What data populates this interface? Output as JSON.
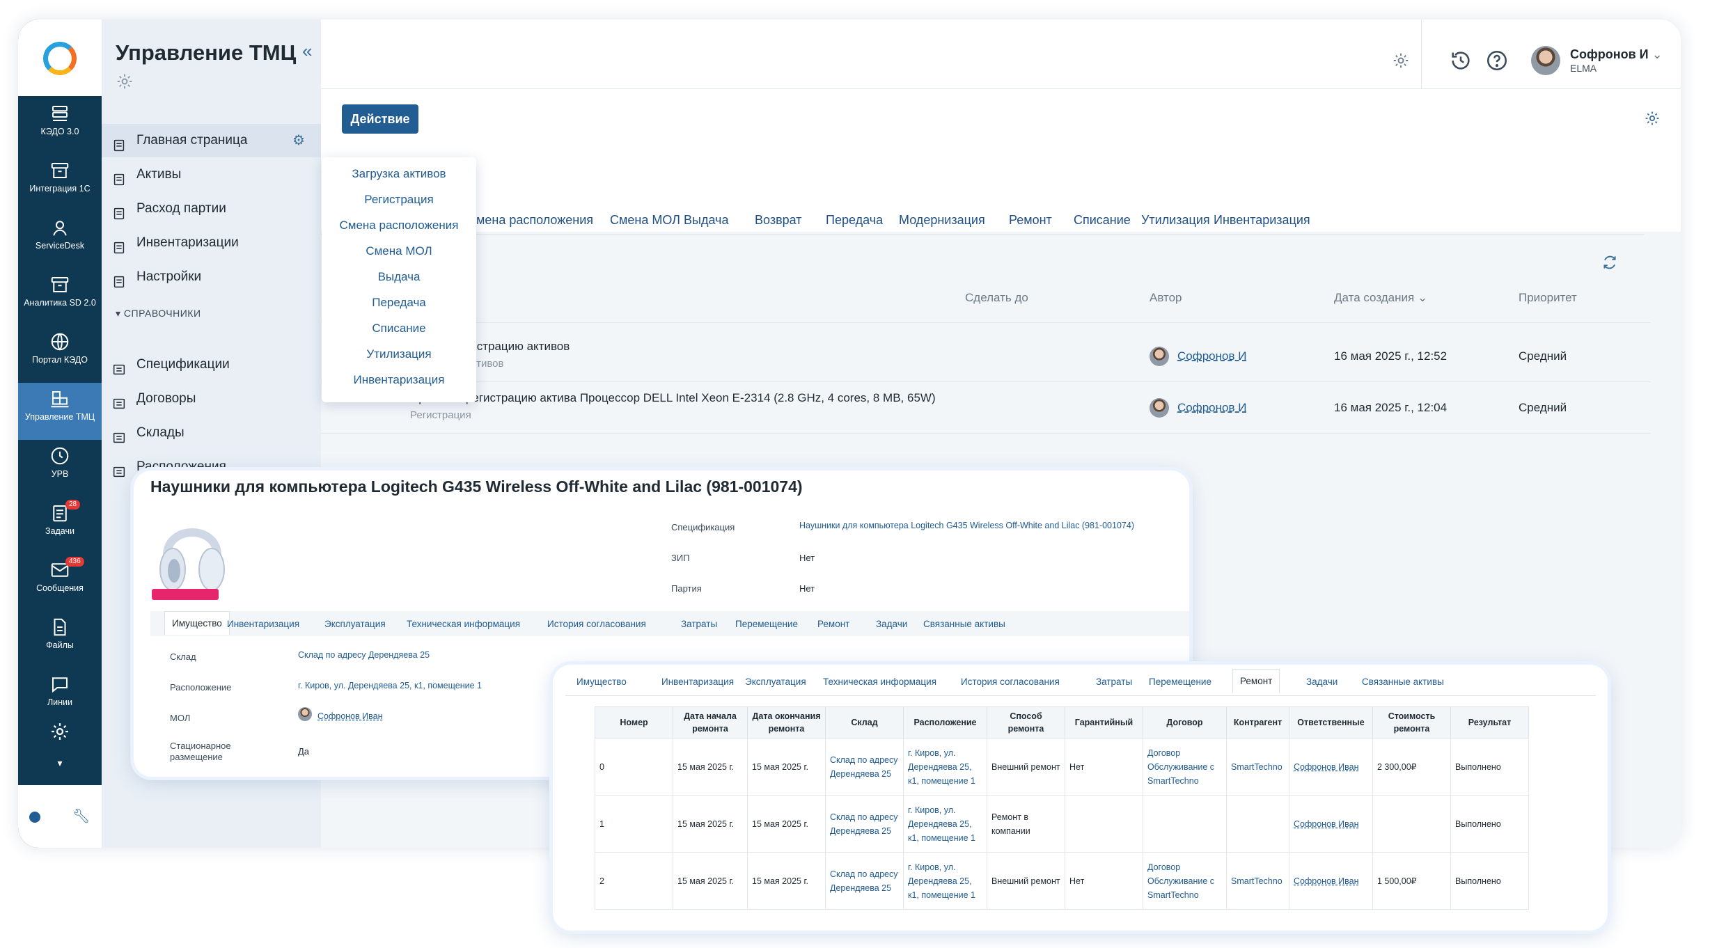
{
  "rail": {
    "items": [
      {
        "label": "КЭДО 3.0",
        "icon": "kedo-icon"
      },
      {
        "label": "Интеграция 1С",
        "icon": "archive-icon"
      },
      {
        "label": "ServiceDesk",
        "icon": "support-agent-icon"
      },
      {
        "label": "Аналитика SD 2.0",
        "icon": "archive-icon"
      },
      {
        "label": "Портал КЭДО",
        "icon": "globe-icon"
      },
      {
        "label": "Управление ТМЦ",
        "icon": "boxes-icon"
      },
      {
        "label": "УРВ",
        "icon": "clock-icon"
      },
      {
        "label": "Задачи",
        "icon": "tasks-icon",
        "badge": "28"
      },
      {
        "label": "Сообщения",
        "icon": "mail-icon",
        "badge": "436"
      },
      {
        "label": "Файлы",
        "icon": "file-icon"
      },
      {
        "label": "Линии",
        "icon": "chat-icon"
      }
    ]
  },
  "nav": {
    "title": "Управление ТМЦ",
    "items": [
      "Главная страница",
      "Активы",
      "Расход партии",
      "Инвентаризации",
      "Настройки"
    ],
    "section": "СПРАВОЧНИКИ",
    "refs": [
      "Спецификации",
      "Договоры",
      "Склады",
      "Расположения"
    ]
  },
  "topbar": {
    "user": "Софронов И",
    "org": "ELMA"
  },
  "action": {
    "label": "Действие"
  },
  "dropdown": [
    "Загрузка активов",
    "Регистрация",
    "Смена расположения",
    "Смена МОЛ",
    "Выдача",
    "Передача",
    "Списание",
    "Утилизация",
    "Инвентаризация"
  ],
  "tabs": [
    "Смена расположения",
    "Смена МОЛ",
    "Выдача",
    "Возврат",
    "Передача",
    "Модернизация",
    "Ремонт",
    "Списание",
    "Утилизация",
    "Инвентаризация"
  ],
  "tasks": {
    "headers": {
      "due": "Сделать до",
      "author": "Автор",
      "created": "Дата создания",
      "priority": "Приоритет"
    },
    "rows": [
      {
        "title": "гистрацию активов",
        "sub": "активов",
        "author": "Софронов И",
        "created": "16 мая 2025 г., 12:52",
        "priority": "Средний"
      },
      {
        "title": "Провести регистрацию актива Процессор DELL Intel Xeon E-2314 (2.8 GHz, 4 cores, 8 MB, 65W)",
        "sub": "Регистрация",
        "author": "Софронов И",
        "created": "16 мая 2025 г., 12:04",
        "priority": "Средний"
      }
    ]
  },
  "card1": {
    "title": "Наушники для компьютера Logitech G435 Wireless Off-White and Lilac (981-001074)",
    "spec_label": "Спецификация",
    "spec_value": "Наушники для компьютера Logitech G435 Wireless Off-White and Lilac (981-001074)",
    "zip_label": "ЗИП",
    "zip_value": "Нет",
    "batch_label": "Партия",
    "batch_value": "Нет",
    "tabs": [
      "Имущество",
      "Инвентаризация",
      "Эксплуатация",
      "Техническая информация",
      "История согласования",
      "Затраты",
      "Перемещение",
      "Ремонт",
      "Задачи",
      "Связанные активы"
    ],
    "warehouse_label": "Склад",
    "warehouse_value": "Склад по адресу Дерендяева 25",
    "location_label": "Расположение",
    "location_value": "г. Киров, ул. Дерендяева 25, к1, помещение 1",
    "mol_label": "МОЛ",
    "mol_value": "Софронов Иван",
    "stationary_label": "Стационарное размещение",
    "stationary_value": "Да"
  },
  "card2": {
    "tabs": [
      "Имущество",
      "Инвентаризация",
      "Эксплуатация",
      "Техническая информация",
      "История согласования",
      "Затраты",
      "Перемещение",
      "Ремонт",
      "Задачи",
      "Связанные активы"
    ],
    "columns": [
      "Номер",
      "Дата начала ремонта",
      "Дата окончания ремонта",
      "Склад",
      "Расположение",
      "Способ ремонта",
      "Гарантийный",
      "Договор",
      "Контрагент",
      "Ответственные",
      "Стоимость ремонта",
      "Результат"
    ],
    "rows": [
      {
        "num": "0",
        "start": "15 мая 2025 г.",
        "end": "15 мая 2025 г.",
        "wh": "Склад по адресу Дерендяева 25",
        "loc": "г. Киров, ул. Дерендяева 25, к1, помещение 1",
        "method": "Внешний ремонт",
        "warranty": "Нет",
        "contract": "Договор Обслуживание с SmartTechno",
        "contractor": "SmartTechno",
        "resp": "Софронов Иван",
        "cost": "2 300,00₽",
        "result": "Выполнено"
      },
      {
        "num": "1",
        "start": "15 мая 2025 г.",
        "end": "15 мая 2025 г.",
        "wh": "Склад по адресу Дерендяева 25",
        "loc": "г. Киров, ул. Дерендяева 25, к1, помещение 1",
        "method": "Ремонт в компании",
        "warranty": "",
        "contract": "",
        "contractor": "",
        "resp": "Софронов Иван",
        "cost": "",
        "result": "Выполнено"
      },
      {
        "num": "2",
        "start": "15 мая 2025 г.",
        "end": "15 мая 2025 г.",
        "wh": "Склад по адресу Дерендяева 25",
        "loc": "г. Киров, ул. Дерендяева 25, к1, помещение 1",
        "method": "Внешний ремонт",
        "warranty": "Нет",
        "contract": "Договор Обслуживание с SmartTechno",
        "contractor": "SmartTechno",
        "resp": "Софронов Иван",
        "cost": "1 500,00₽",
        "result": "Выполнено"
      }
    ]
  }
}
